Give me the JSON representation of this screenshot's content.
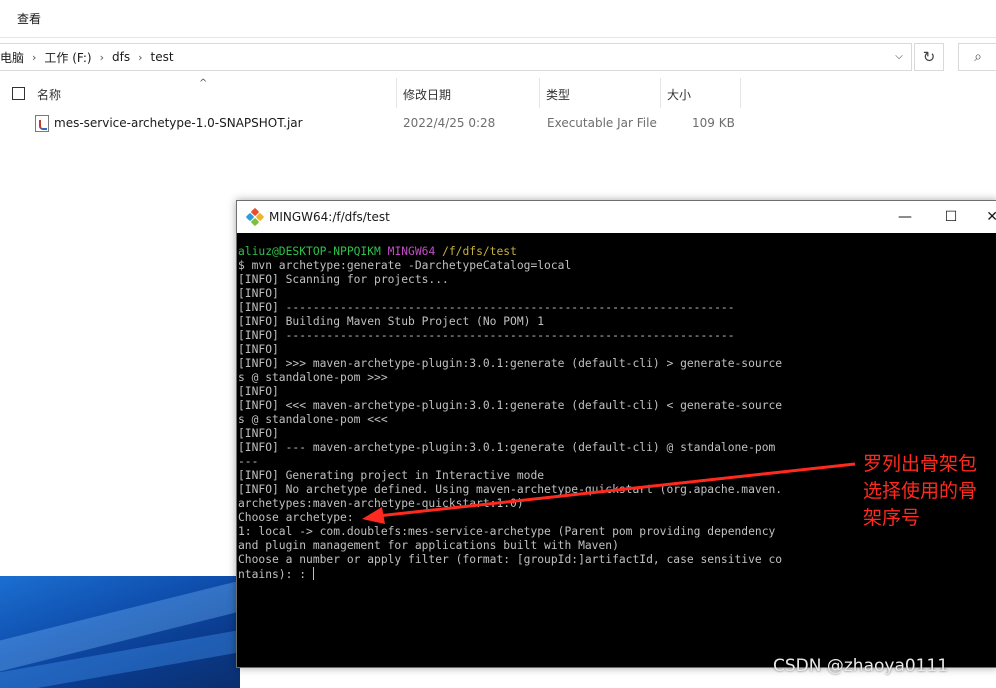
{
  "explorer": {
    "ribbon_tab": "查看",
    "breadcrumb": [
      "电脑",
      "工作 (F:)",
      "dfs",
      "test"
    ],
    "columns": [
      "名称",
      "修改日期",
      "类型",
      "大小"
    ],
    "files": [
      {
        "name": "mes-service-archetype-1.0-SNAPSHOT.jar",
        "date": "2022/4/25 0:28",
        "type": "Executable Jar File",
        "size": "109 KB"
      }
    ]
  },
  "terminal": {
    "title": "MINGW64:/f/dfs/test",
    "prompt": {
      "user": "aliuz@DESKTOP-NPPQIKM",
      "host": "MINGW64",
      "path": "/f/dfs/test"
    },
    "lines": [
      "$ mvn archetype:generate -DarchetypeCatalog=local",
      "[INFO] Scanning for projects...",
      "[INFO]",
      "[INFO] ------------------------------------------------------------------",
      "[INFO] Building Maven Stub Project (No POM) 1",
      "[INFO] ------------------------------------------------------------------",
      "[INFO]",
      "[INFO] >>> maven-archetype-plugin:3.0.1:generate (default-cli) > generate-source",
      "s @ standalone-pom >>>",
      "[INFO]",
      "[INFO] <<< maven-archetype-plugin:3.0.1:generate (default-cli) < generate-source",
      "s @ standalone-pom <<<",
      "[INFO]",
      "[INFO] --- maven-archetype-plugin:3.0.1:generate (default-cli) @ standalone-pom",
      "---",
      "[INFO] Generating project in Interactive mode",
      "[INFO] No archetype defined. Using maven-archetype-quickstart (org.apache.maven.",
      "archetypes:maven-archetype-quickstart:1.0)",
      "Choose archetype:",
      "1: local -> com.doublefs:mes-service-archetype (Parent pom providing dependency",
      "and plugin management for applications built with Maven)",
      "Choose a number or apply filter (format: [groupId:]artifactId, case sensitive co"
    ],
    "last_line": "ntains): : "
  },
  "annotation": {
    "lines": [
      "罗列出骨架包",
      "选择使用的骨",
      "架序号"
    ],
    "color": "#ff2a1f"
  },
  "watermark": "CSDN @zhaoya0111"
}
